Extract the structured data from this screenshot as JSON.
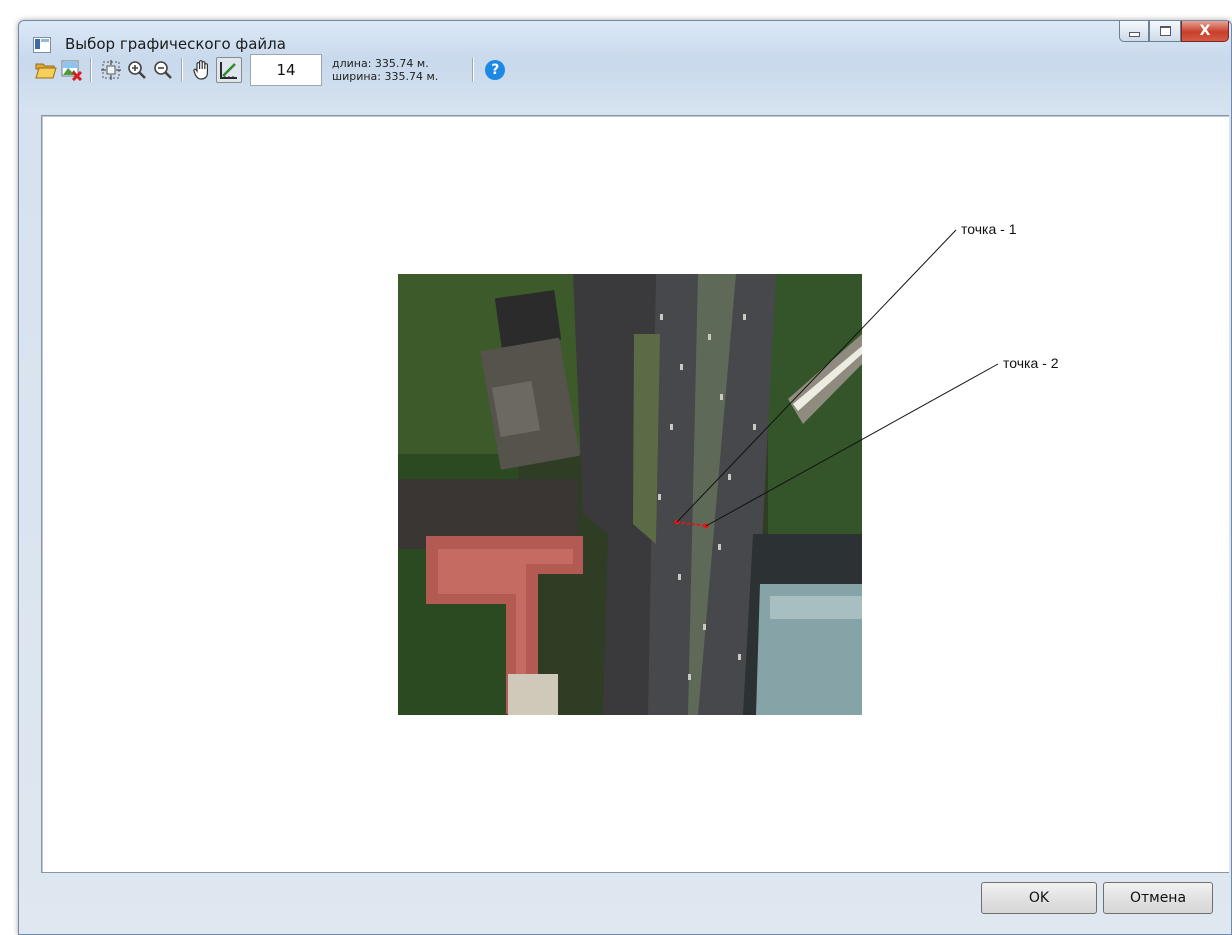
{
  "window": {
    "title": "Выбор графического файла",
    "close_glyph": "X"
  },
  "toolbar": {
    "buttons": [
      {
        "icon": "open-folder-icon"
      },
      {
        "icon": "remove-image-icon"
      },
      {
        "icon": "fit-extent-icon"
      },
      {
        "icon": "zoom-in-icon"
      },
      {
        "icon": "zoom-out-icon"
      },
      {
        "icon": "pan-hand-icon"
      },
      {
        "icon": "measure-icon",
        "active": true
      }
    ],
    "zoom_value": "14",
    "length_text": "длина:   335.74 м.",
    "width_text": "ширина: 335.74 м.",
    "help_glyph": "?"
  },
  "map": {
    "point1_label": "точка - 1",
    "point2_label": "точка - 2",
    "marker_color": "#e01818"
  },
  "dialog": {
    "ok_label": "OK",
    "cancel_label": "Отмена"
  }
}
